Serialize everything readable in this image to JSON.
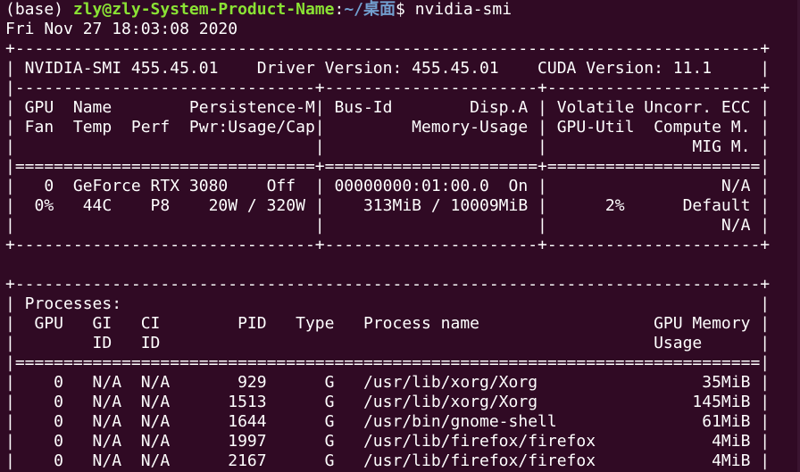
{
  "prompt": {
    "env": "(base) ",
    "user_host": "zly@zly-System-Product-Name",
    "sep": ":",
    "path": "~/桌面",
    "symbol": "$ ",
    "command": "nvidia-smi"
  },
  "lines": [
    "Fri Nov 27 18:03:08 2020",
    "+-----------------------------------------------------------------------------+",
    "| NVIDIA-SMI 455.45.01    Driver Version: 455.45.01    CUDA Version: 11.1     |",
    "|-------------------------------+----------------------+----------------------+",
    "| GPU  Name        Persistence-M| Bus-Id        Disp.A | Volatile Uncorr. ECC |",
    "| Fan  Temp  Perf  Pwr:Usage/Cap|         Memory-Usage | GPU-Util  Compute M. |",
    "|                               |                      |               MIG M. |",
    "|===============================+======================+======================|",
    "|   0  GeForce RTX 3080    Off  | 00000000:01:00.0  On |                  N/A |",
    "|  0%   44C    P8    20W / 320W |    313MiB / 10009MiB |      2%      Default |",
    "|                               |                      |                  N/A |",
    "+-------------------------------+----------------------+----------------------+",
    "",
    "+-----------------------------------------------------------------------------+",
    "| Processes:                                                                  |",
    "|  GPU   GI   CI        PID   Type   Process name                  GPU Memory |",
    "|        ID   ID                                                   Usage      |",
    "|=============================================================================|",
    "|    0   N/A  N/A       929      G   /usr/lib/xorg/Xorg                 35MiB |",
    "|    0   N/A  N/A      1513      G   /usr/lib/xorg/Xorg                145MiB |",
    "|    0   N/A  N/A      1644      G   /usr/bin/gnome-shell               61MiB |",
    "|    0   N/A  N/A      1997      G   /usr/lib/firefox/firefox            4MiB |",
    "|    0   N/A  N/A      2167      G   /usr/lib/firefox/firefox            4MiB |"
  ],
  "colors": {
    "background": "#300a24",
    "text": "#ffffff",
    "user_host": "#8ae234",
    "path": "#729fcf"
  }
}
